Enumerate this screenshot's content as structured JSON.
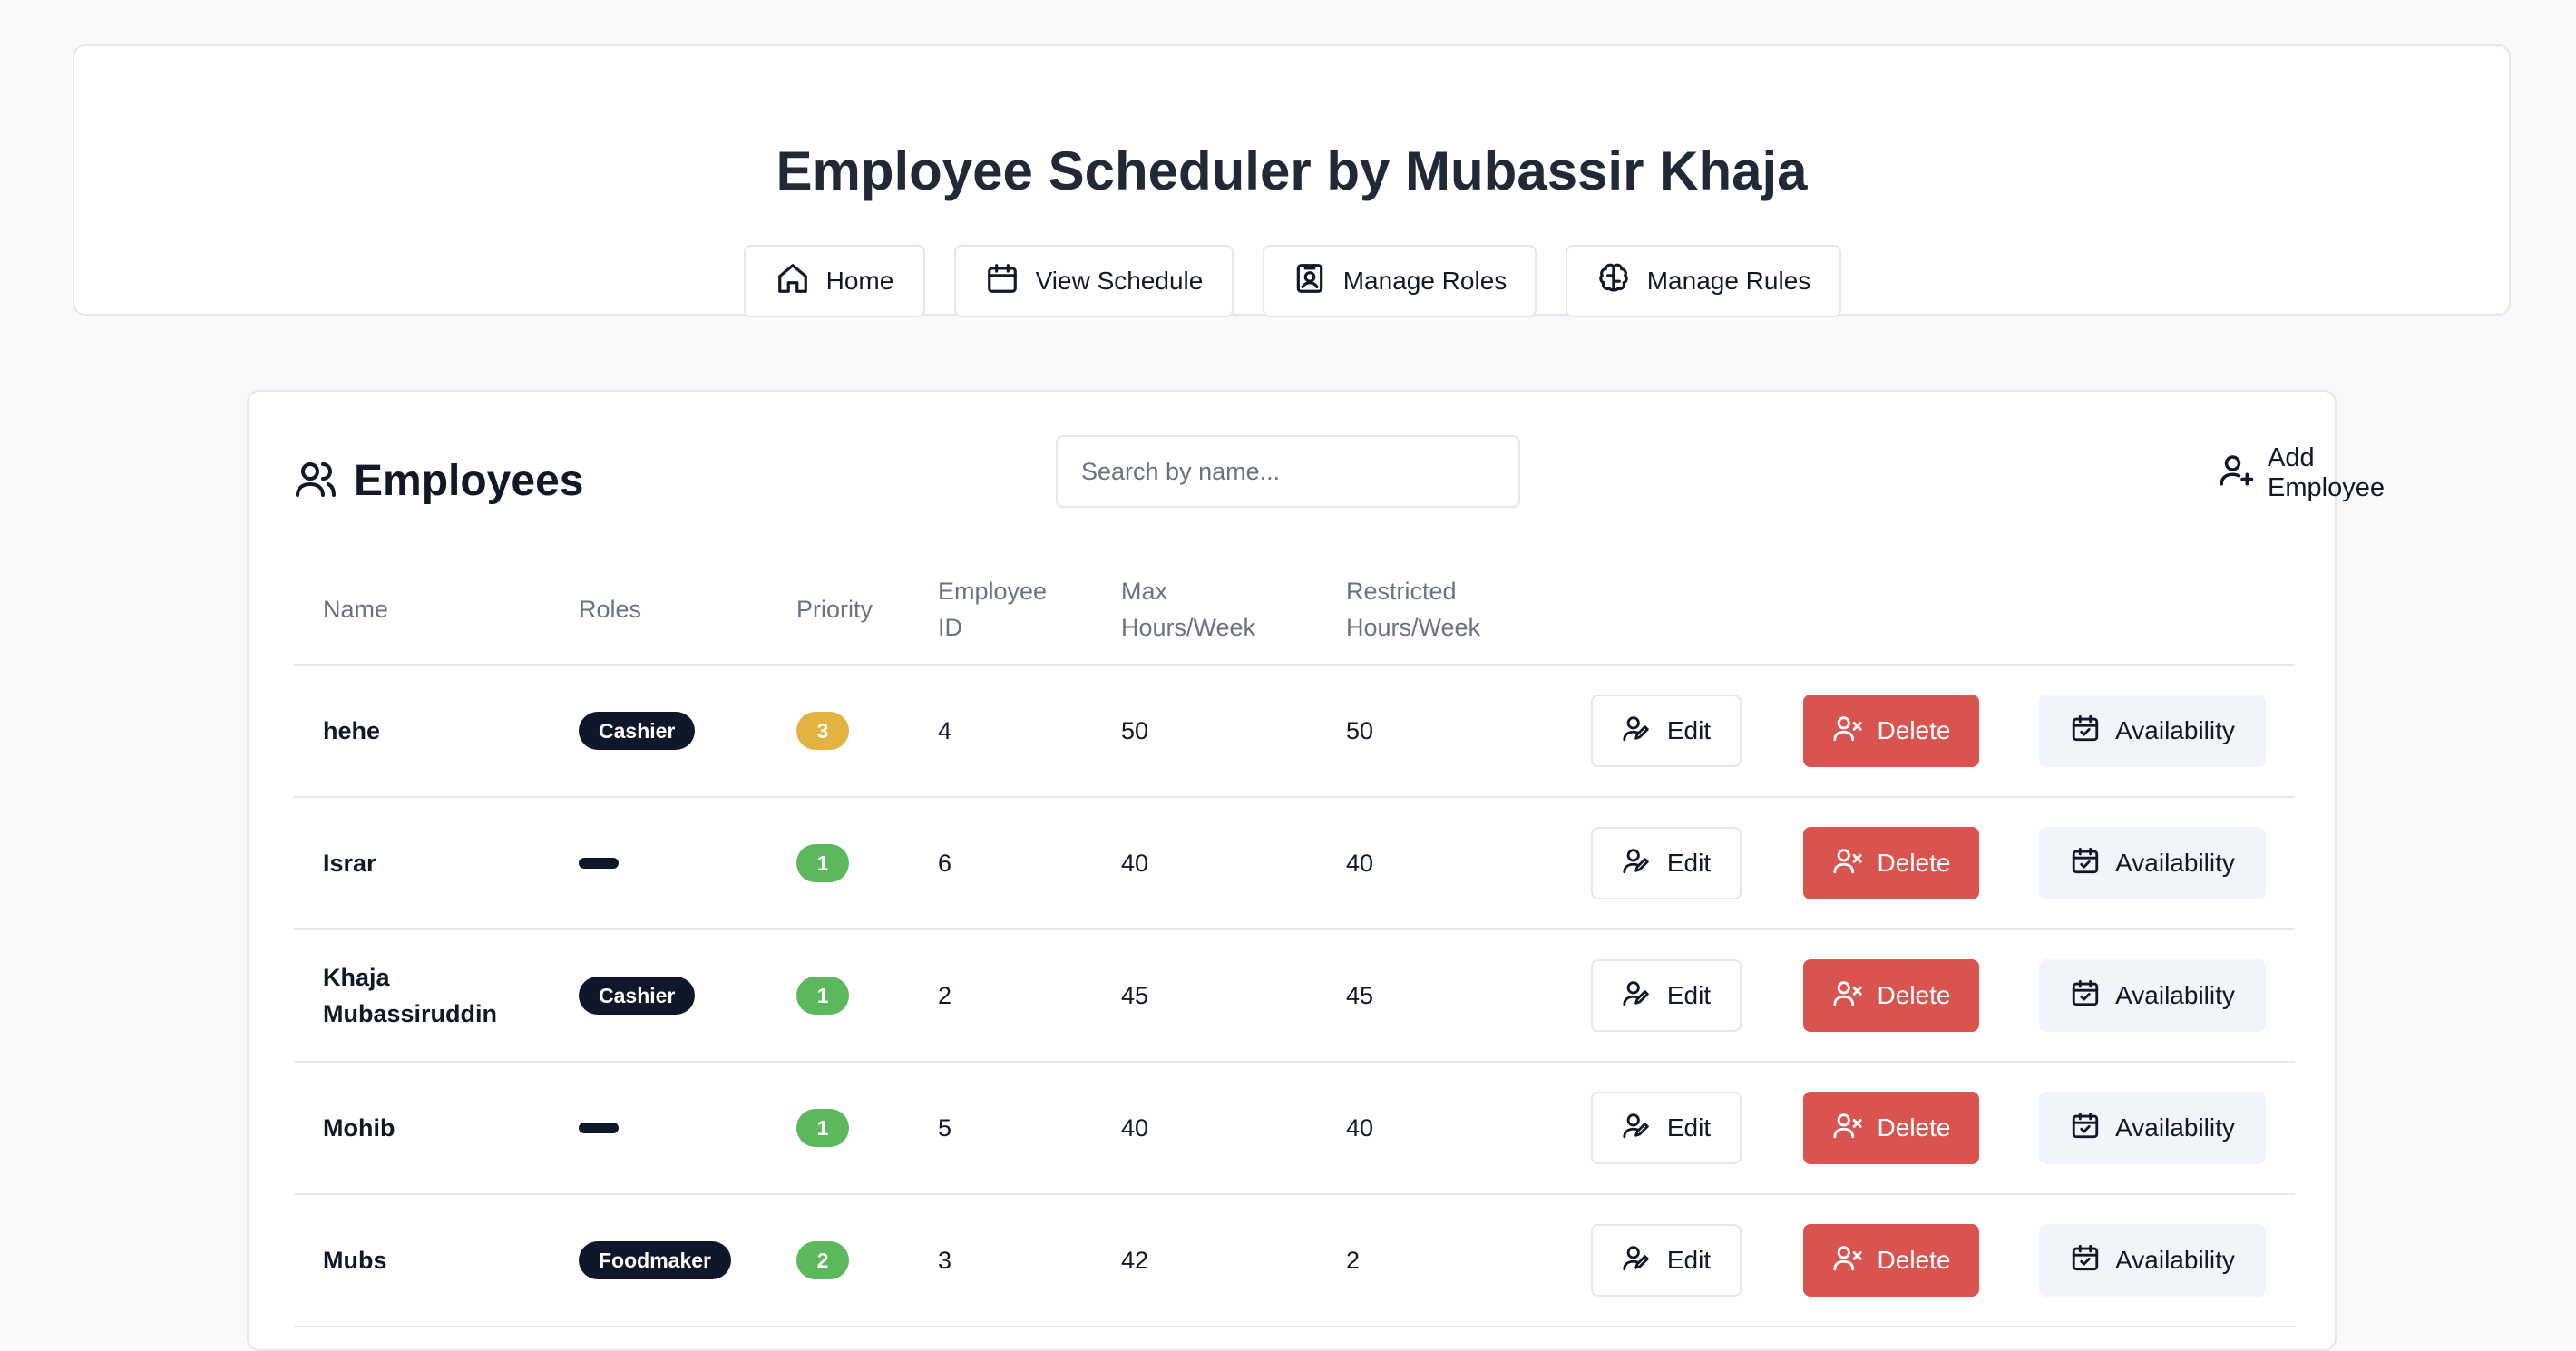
{
  "header": {
    "title": "Employee Scheduler by Mubassir Khaja",
    "nav": [
      {
        "label": "Home",
        "icon": "home-icon"
      },
      {
        "label": "View Schedule",
        "icon": "calendar-icon"
      },
      {
        "label": "Manage Roles",
        "icon": "id-badge-icon"
      },
      {
        "label": "Manage Rules",
        "icon": "brain-icon"
      }
    ]
  },
  "employees_panel": {
    "title": "Employees",
    "title_icon": "users-icon",
    "search": {
      "placeholder": "Search by name...",
      "value": ""
    },
    "add_button": {
      "label": "Add Employee",
      "icon": "user-plus-icon"
    },
    "columns": {
      "name": "Name",
      "roles": "Roles",
      "priority": "Priority",
      "employee_id": "Employee ID",
      "max_hours": "Max Hours/Week",
      "restricted_hours": "Restricted Hours/Week"
    },
    "actions": {
      "edit": "Edit",
      "delete": "Delete",
      "availability": "Availability"
    },
    "rows": [
      {
        "name": "hehe",
        "role": "Cashier",
        "priority": "3",
        "priority_color": "#e3b341",
        "employee_id": "4",
        "max_hours": "50",
        "restricted_hours": "50"
      },
      {
        "name": "Israr",
        "role": "",
        "priority": "1",
        "priority_color": "#5cb85c",
        "employee_id": "6",
        "max_hours": "40",
        "restricted_hours": "40"
      },
      {
        "name": "Khaja Mubassiruddin",
        "role": "Cashier",
        "priority": "1",
        "priority_color": "#5cb85c",
        "employee_id": "2",
        "max_hours": "45",
        "restricted_hours": "45"
      },
      {
        "name": "Mohib",
        "role": "",
        "priority": "1",
        "priority_color": "#5cb85c",
        "employee_id": "5",
        "max_hours": "40",
        "restricted_hours": "40"
      },
      {
        "name": "Mubs",
        "role": "Foodmaker",
        "priority": "2",
        "priority_color": "#5cb85c",
        "employee_id": "3",
        "max_hours": "42",
        "restricted_hours": "2"
      }
    ]
  },
  "colors": {
    "background": "#f8f9fb",
    "badge_dark": "#0f172a",
    "delete_red": "#d9534f",
    "availability_bg": "#f1f5f9"
  }
}
